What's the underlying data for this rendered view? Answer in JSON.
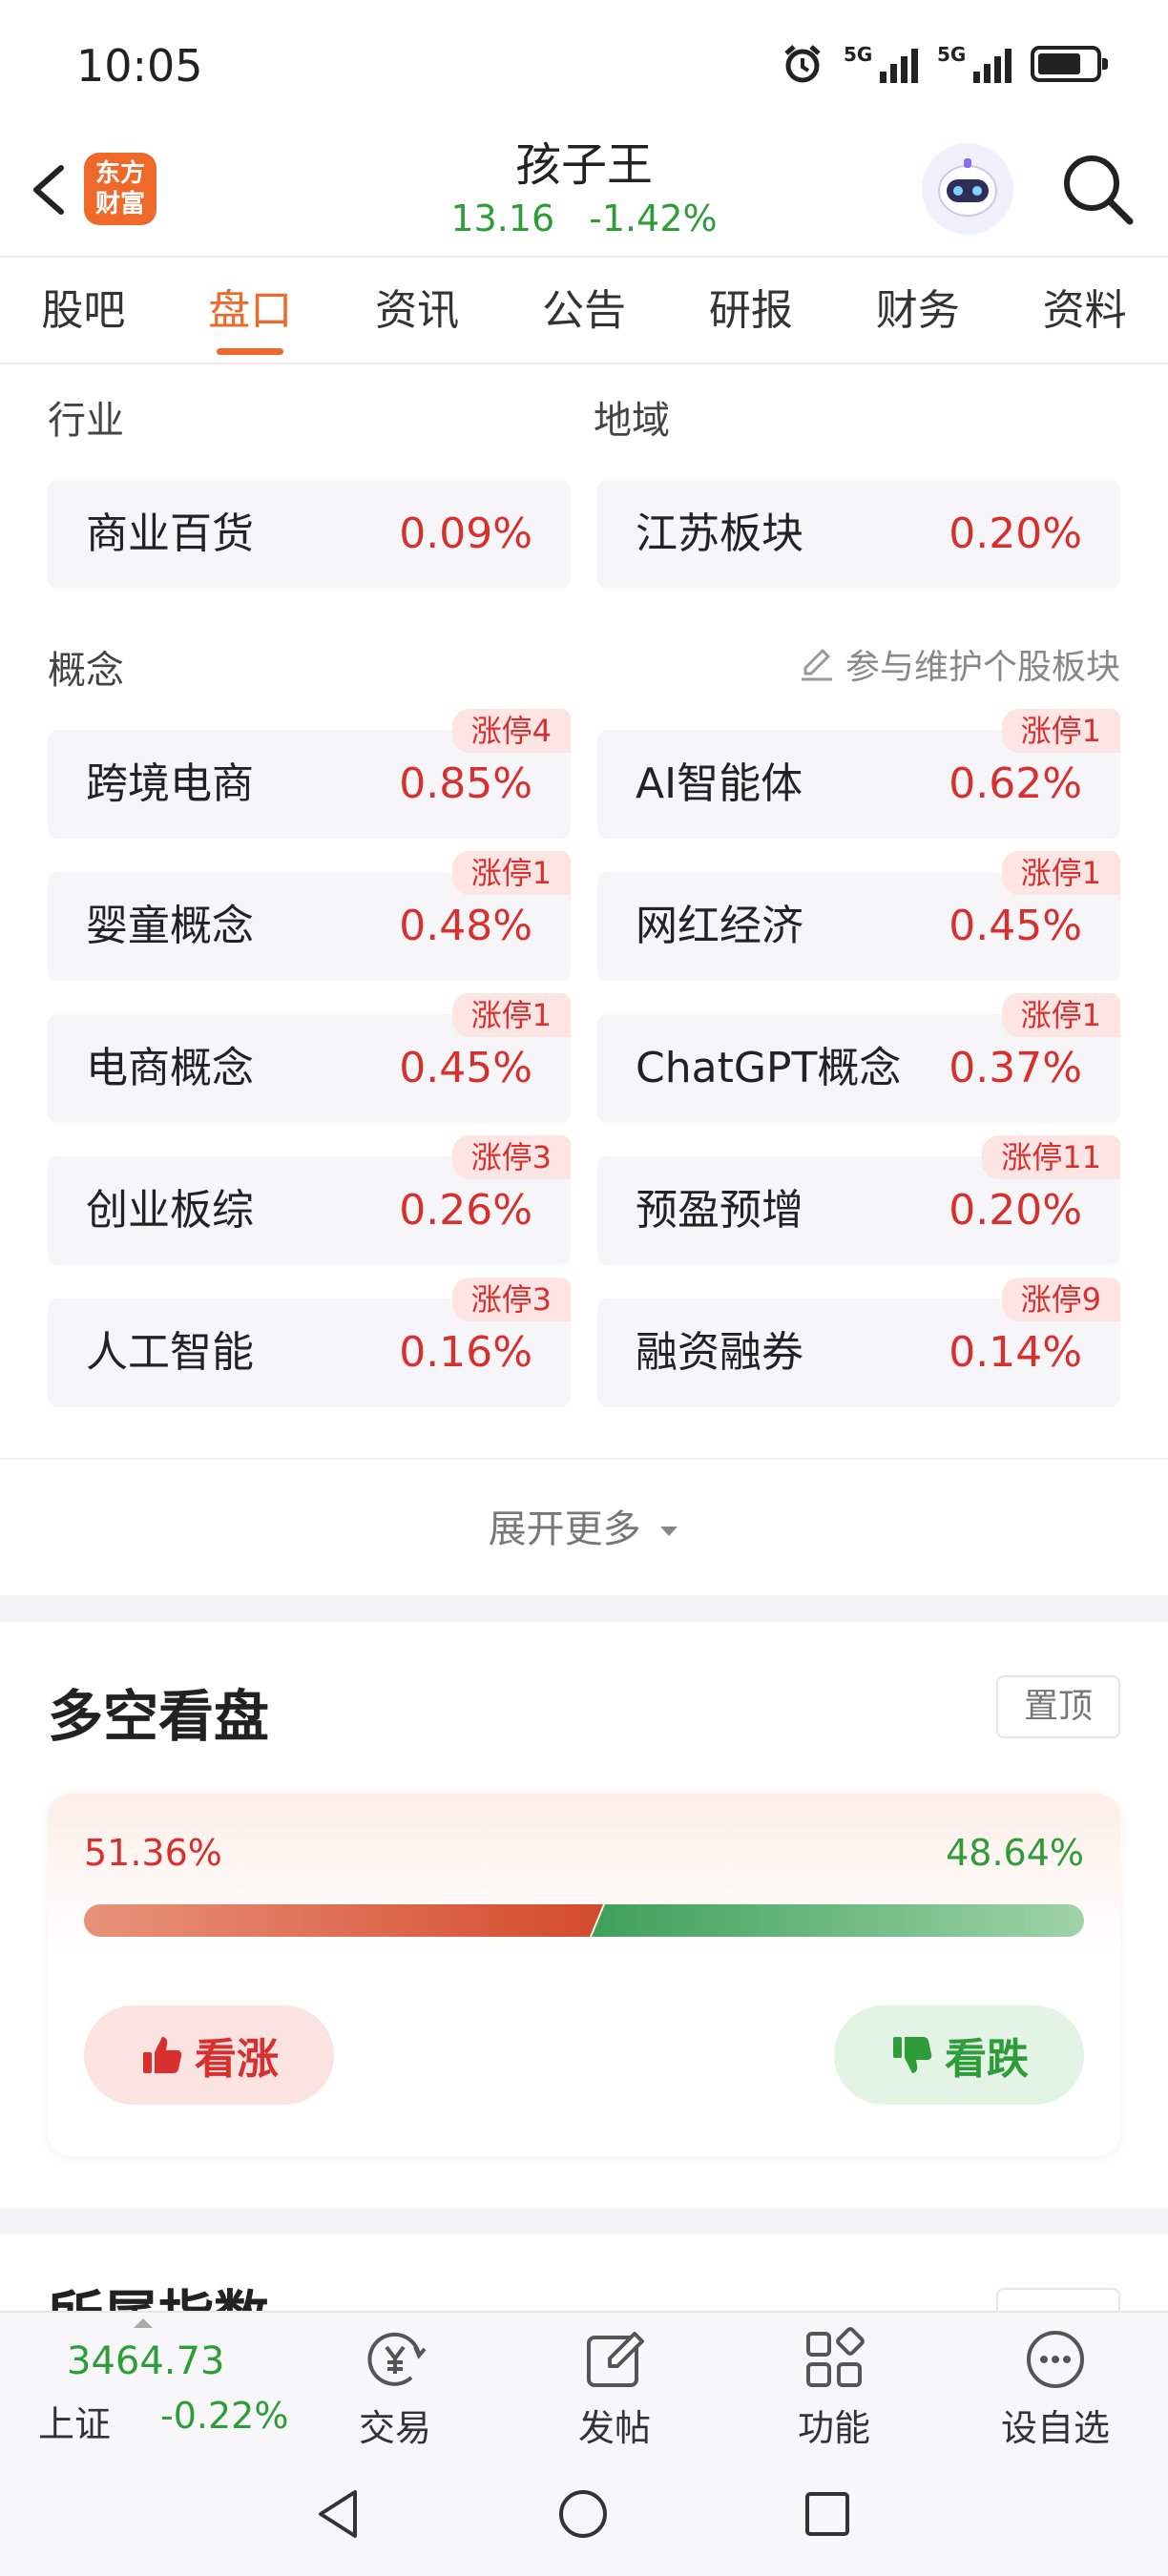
{
  "status_bar": {
    "time": "10:05",
    "net1": "5G",
    "net2": "5G"
  },
  "header": {
    "logo_line1": "东方",
    "logo_line2": "财富",
    "title": "孩子王",
    "price": "13.16",
    "change": "-1.42%"
  },
  "tabs": [
    "股吧",
    "盘口",
    "资讯",
    "公告",
    "研报",
    "财务",
    "资料"
  ],
  "industry": {
    "label": "行业",
    "name": "商业百货",
    "pct": "0.09%"
  },
  "region": {
    "label": "地域",
    "name": "江苏板块",
    "pct": "0.20%"
  },
  "concept": {
    "label": "概念",
    "maintain_link": "参与维护个股板块",
    "items": [
      {
        "name": "跨境电商",
        "pct": "0.85%",
        "badge": "涨停4"
      },
      {
        "name": "AI智能体",
        "pct": "0.62%",
        "badge": "涨停1"
      },
      {
        "name": "婴童概念",
        "pct": "0.48%",
        "badge": "涨停1"
      },
      {
        "name": "网红经济",
        "pct": "0.45%",
        "badge": "涨停1"
      },
      {
        "name": "电商概念",
        "pct": "0.45%",
        "badge": "涨停1"
      },
      {
        "name": "ChatGPT概念",
        "pct": "0.37%",
        "badge": "涨停1"
      },
      {
        "name": "创业板综",
        "pct": "0.26%",
        "badge": "涨停3"
      },
      {
        "name": "预盈预增",
        "pct": "0.20%",
        "badge": "涨停11"
      },
      {
        "name": "人工智能",
        "pct": "0.16%",
        "badge": "涨停3"
      },
      {
        "name": "融资融券",
        "pct": "0.14%",
        "badge": "涨停9"
      }
    ]
  },
  "expand_more": "展开更多",
  "long_short": {
    "title": "多空看盘",
    "pin_label": "置顶",
    "bull_pct": "51.36%",
    "bear_pct": "48.64%",
    "bull_ratio": 0.5136,
    "bull_label": "看涨",
    "bear_label": "看跌",
    "bull_color": "#d8302f",
    "bear_color": "#2f9c3a"
  },
  "next_section_title": "所属指数",
  "bottom_bar": {
    "index_value": "3464.73",
    "index_name": "上证",
    "index_change": "-0.22%",
    "items": [
      {
        "label": "交易",
        "icon": "trade-yen-icon"
      },
      {
        "label": "发帖",
        "icon": "edit-post-icon"
      },
      {
        "label": "功能",
        "icon": "grid-apps-icon"
      },
      {
        "label": "设自选",
        "icon": "more-dots-icon"
      }
    ]
  },
  "colors": {
    "accent": "#ef6a2a",
    "up": "#d8302f",
    "down": "#2f9c3a"
  }
}
